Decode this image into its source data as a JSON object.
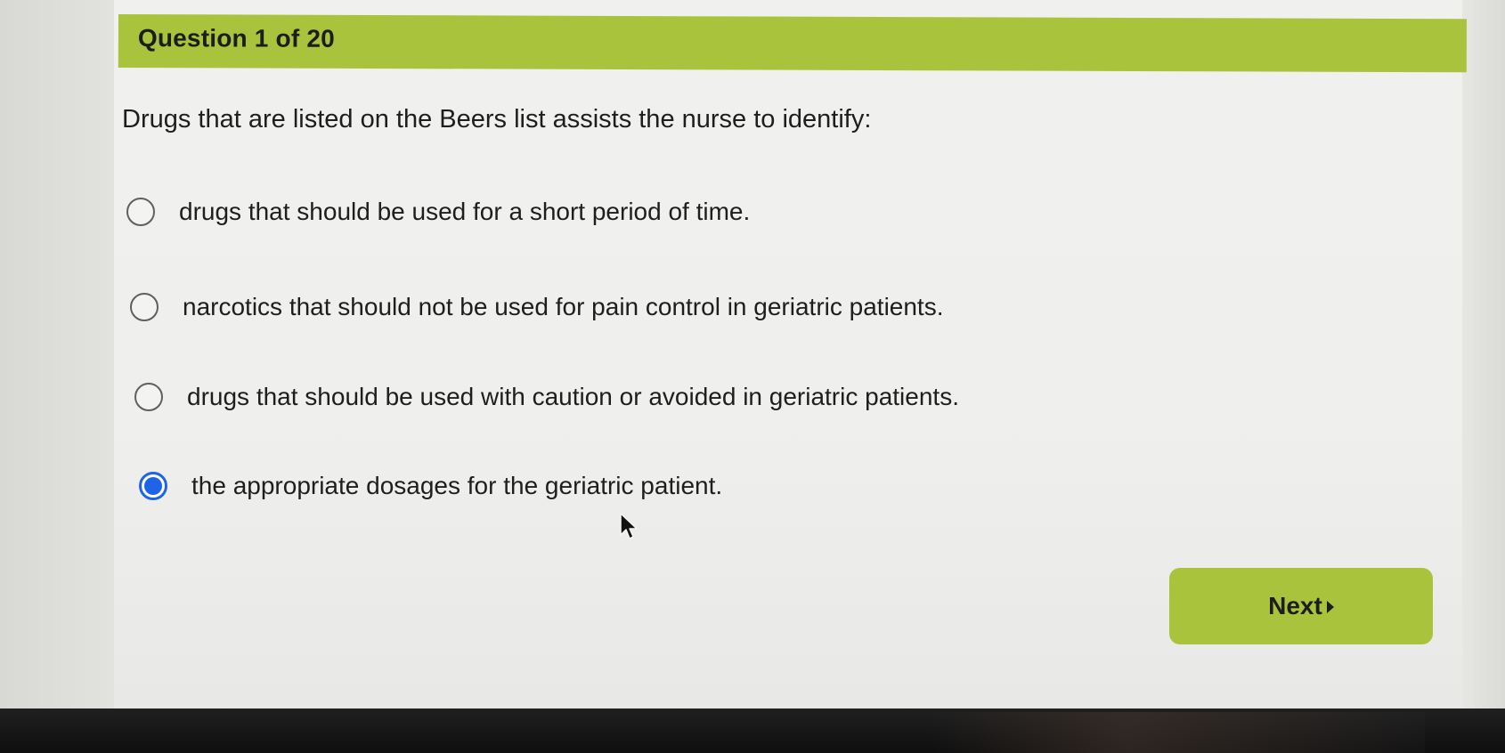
{
  "quiz": {
    "header": {
      "title": "Question 1 of 20",
      "color": "#a9c43c"
    },
    "question": "Drugs that are listed on the Beers list assists the nurse to identify:",
    "options": [
      {
        "label": "drugs that should be used for a short period of time.",
        "selected": false
      },
      {
        "label": "narcotics that should not be used for pain control in geriatric patients.",
        "selected": false
      },
      {
        "label": "drugs that should be used with caution or avoided in geriatric patients.",
        "selected": false
      },
      {
        "label": "the appropriate dosages for the geriatric patient.",
        "selected": true
      }
    ],
    "next_button": {
      "label": "Next",
      "icon": "caret-right-icon",
      "color": "#a9c43c"
    },
    "selected_color": "#1f64e6"
  },
  "pointer": {
    "icon": "mouse-pointer-icon"
  }
}
